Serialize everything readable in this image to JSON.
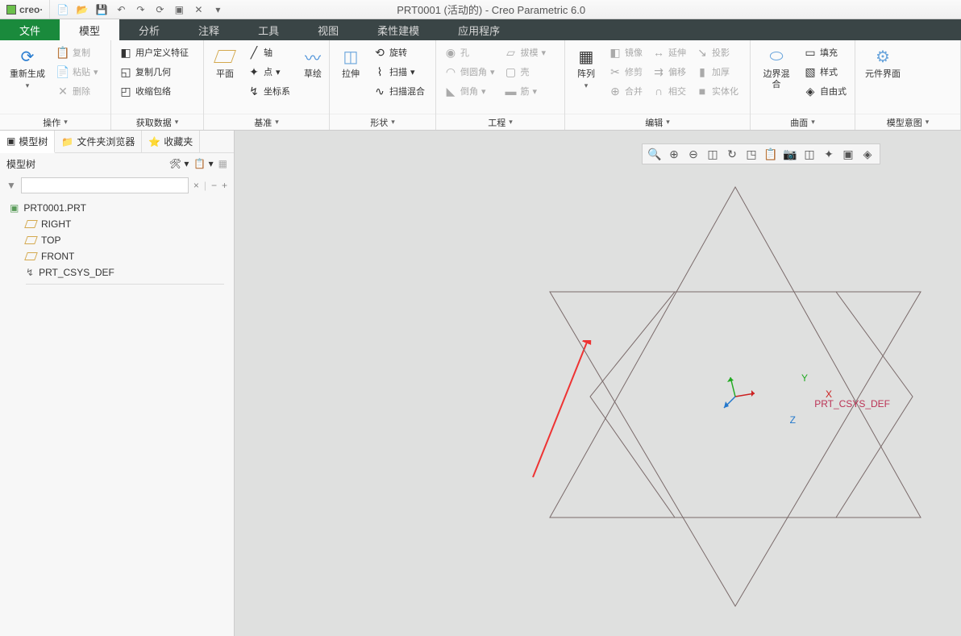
{
  "title": "PRT0001 (活动的) - Creo Parametric 6.0",
  "logo": "creo·",
  "menu": {
    "file": "文件",
    "model": "模型",
    "analysis": "分析",
    "annotate": "注释",
    "tools": "工具",
    "view": "视图",
    "flex": "柔性建模",
    "apps": "应用程序"
  },
  "ribbon": {
    "regen": "重新生成",
    "copy": "复制",
    "paste": "粘贴",
    "delete": "删除",
    "ops_label": "操作",
    "udf": "用户定义特征",
    "copy_geom": "复制几何",
    "shrinkwrap": "收缩包络",
    "getdata_label": "获取数据",
    "plane": "平面",
    "axis": "轴",
    "point": "点",
    "csys": "坐标系",
    "sketch": "草绘",
    "datum_label": "基准",
    "extrude": "拉伸",
    "revolve": "旋转",
    "sweep": "扫描",
    "sweep_blend": "扫描混合",
    "shape_label": "形状",
    "hole": "孔",
    "round": "倒圆角",
    "chamfer": "倒角",
    "draft": "拔模",
    "shell": "壳",
    "rib": "筋",
    "eng_label": "工程",
    "pattern": "阵列",
    "mirror": "镜像",
    "trim": "修剪",
    "merge": "合并",
    "extend": "延伸",
    "offset": "偏移",
    "intersect": "相交",
    "project": "投影",
    "thicken": "加厚",
    "solidify": "实体化",
    "edit_label": "编辑",
    "boundary": "边界混合",
    "fill": "填充",
    "style": "样式",
    "freestyle": "自由式",
    "surface_label": "曲面",
    "comp_iface": "元件界面",
    "intent_label": "模型意图"
  },
  "left": {
    "tabs": {
      "tree": "模型树",
      "folders": "文件夹浏览器",
      "fav": "收藏夹"
    },
    "tree_label": "模型树",
    "root": "PRT0001.PRT",
    "planes": [
      "RIGHT",
      "TOP",
      "FRONT"
    ],
    "csys": "PRT_CSYS_DEF"
  },
  "canvas": {
    "axes": {
      "x": "X",
      "y": "Y",
      "z": "Z"
    },
    "csys_label": "PRT_CSYS_DEF"
  }
}
